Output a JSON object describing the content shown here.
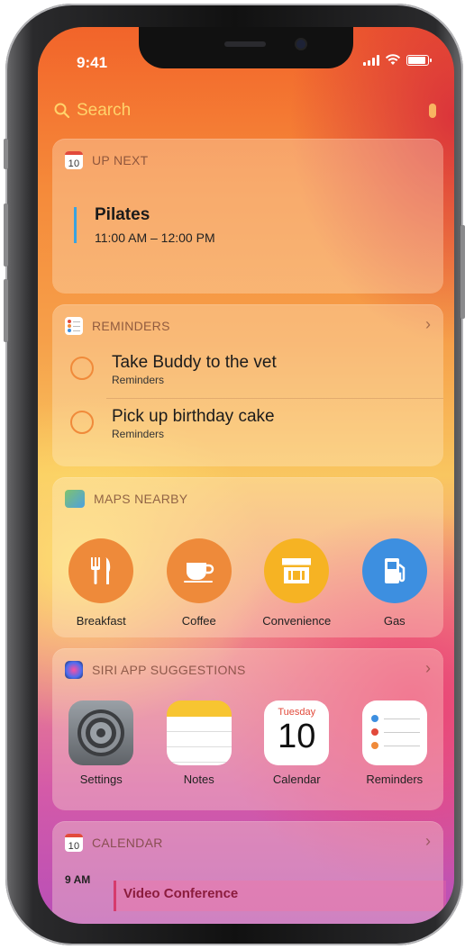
{
  "status_bar": {
    "time": "9:41"
  },
  "search": {
    "placeholder": "Search"
  },
  "up_next": {
    "header": "UP NEXT",
    "icon_day": "10",
    "event_title": "Pilates",
    "event_time": "11:00 AM – 12:00 PM"
  },
  "reminders": {
    "header": "REMINDERS",
    "items": [
      {
        "title": "Take Buddy to the vet",
        "list": "Reminders"
      },
      {
        "title": "Pick up birthday cake",
        "list": "Reminders"
      }
    ]
  },
  "maps_nearby": {
    "header": "MAPS NEARBY",
    "items": [
      {
        "label": "Breakfast",
        "icon": "fork-knife-icon",
        "color": "#ee8a3a"
      },
      {
        "label": "Coffee",
        "icon": "coffee-cup-icon",
        "color": "#ee8a3a"
      },
      {
        "label": "Convenience",
        "icon": "storefront-icon",
        "color": "#f6b323"
      },
      {
        "label": "Gas",
        "icon": "gas-pump-icon",
        "color": "#3d8fe0"
      }
    ]
  },
  "siri_suggestions": {
    "header": "SIRI APP SUGGESTIONS",
    "apps": [
      {
        "label": "Settings",
        "icon": "settings-gear-icon"
      },
      {
        "label": "Notes",
        "icon": "notes-icon"
      },
      {
        "label": "Calendar",
        "icon": "calendar-icon",
        "weekday": "Tuesday",
        "day": "10"
      },
      {
        "label": "Reminders",
        "icon": "reminders-list-icon"
      }
    ]
  },
  "calendar": {
    "header": "CALENDAR",
    "icon_day": "10",
    "hour": "9 AM",
    "event_title": "Video Conference"
  }
}
